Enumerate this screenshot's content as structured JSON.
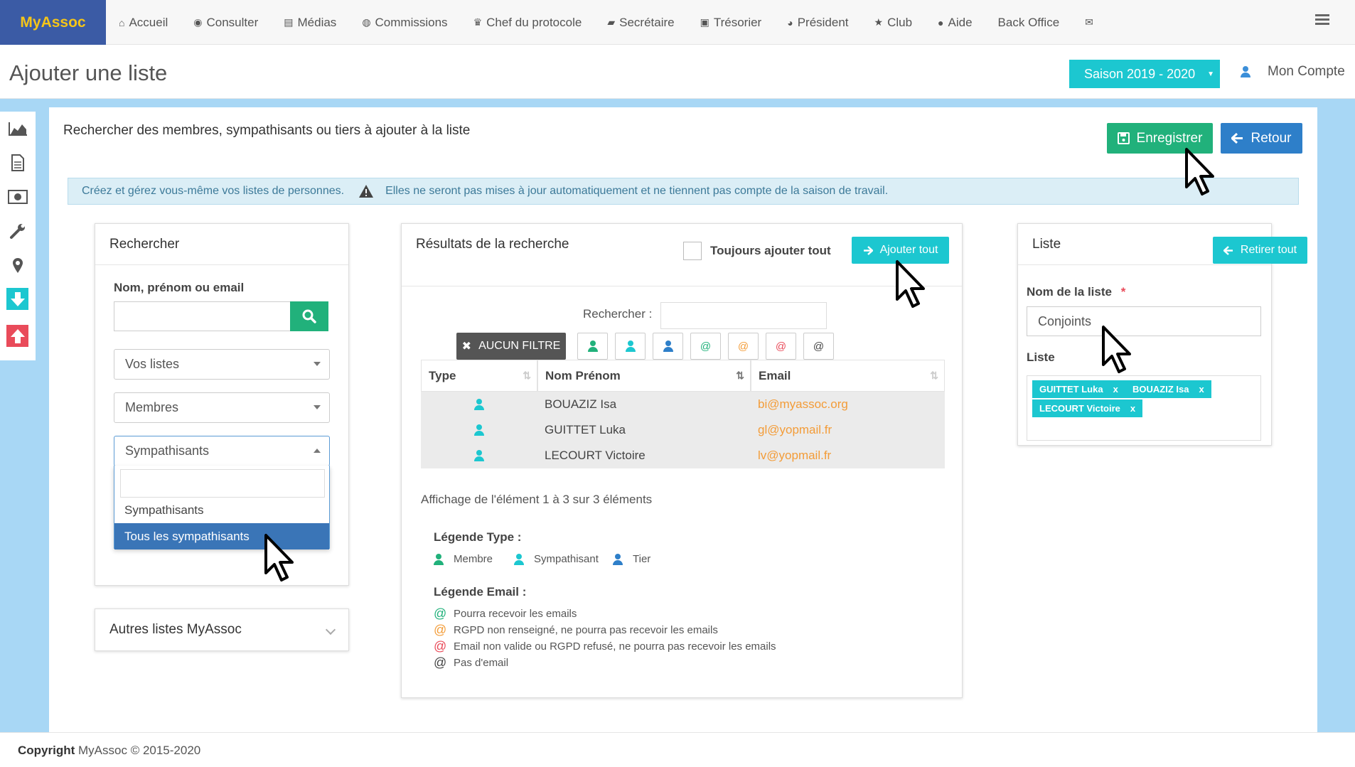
{
  "brand": "MyAssoc",
  "nav": [
    {
      "icon": "home-icon",
      "glyph": "⌂",
      "label": "Accueil"
    },
    {
      "icon": "eye-icon",
      "glyph": "◉",
      "label": "Consulter"
    },
    {
      "icon": "file-icon",
      "glyph": "▤",
      "label": "Médias"
    },
    {
      "icon": "user-circle-icon",
      "glyph": "◍",
      "label": "Commissions"
    },
    {
      "icon": "trophy-icon",
      "glyph": "♛",
      "label": "Chef du protocole"
    },
    {
      "icon": "book-icon",
      "glyph": "▰",
      "label": "Secrétaire"
    },
    {
      "icon": "money-icon",
      "glyph": "▣",
      "label": "Trésorier"
    },
    {
      "icon": "globe-icon",
      "glyph": "◕",
      "label": "Président"
    },
    {
      "icon": "star-icon",
      "glyph": "★",
      "label": "Club"
    },
    {
      "icon": "info-icon",
      "glyph": "●",
      "label": "Aide"
    },
    {
      "icon": "",
      "glyph": "",
      "label": "Back Office"
    },
    {
      "icon": "envelope-icon",
      "glyph": "✉",
      "label": ""
    }
  ],
  "page": {
    "title": "Ajouter une liste",
    "season": "Saison 2019 - 2020",
    "account": "Mon Compte"
  },
  "content": {
    "title": "Rechercher des membres, sympathisants ou tiers à ajouter à la liste",
    "save": "Enregistrer",
    "back": "Retour",
    "info1": "Créez et gérez vous-même vos listes de personnes.",
    "info2": "Elles ne seront pas mises à jour automatiquement et ne tiennent pas compte de la saison de travail."
  },
  "search": {
    "title": "Rechercher",
    "name_label": "Nom, prénom ou email",
    "name_value": "",
    "select1": "Vos listes",
    "select2": "Membres",
    "select3": "Sympathisants",
    "options": [
      "Sympathisants",
      "Tous les sympathisants"
    ],
    "other_lists": "Autres listes MyAssoc"
  },
  "results": {
    "title": "Résultats de la recherche",
    "always_add": "Toujours ajouter tout",
    "add_all": "Ajouter tout",
    "search_label": "Rechercher :",
    "no_filter": "AUCUN FILTRE",
    "columns": [
      "Type",
      "Nom Prénom",
      "Email"
    ],
    "rows": [
      {
        "type": "Sympathisant",
        "name": "BOUAZIZ Isa",
        "email": "bi@myassoc.org"
      },
      {
        "type": "Sympathisant",
        "name": "GUITTET Luka",
        "email": "gl@yopmail.fr"
      },
      {
        "type": "Sympathisant",
        "name": "LECOURT Victoire",
        "email": "lv@yopmail.fr"
      }
    ],
    "showing": "Affichage de l'élément 1 à 3 sur 3 éléments",
    "legend_type_title": "Légende Type :",
    "legend_types": [
      "Membre",
      "Sympathisant",
      "Tier"
    ],
    "legend_email_title": "Légende Email :",
    "legend_emails": [
      {
        "color": "#21b17b",
        "text": "Pourra recevoir les emails"
      },
      {
        "color": "#f39c38",
        "text": "RGPD non renseigné, ne pourra pas recevoir les emails"
      },
      {
        "color": "#e94b5a",
        "text": "Email non valide ou RGPD refusé, ne pourra pas recevoir les emails"
      },
      {
        "color": "#444444",
        "text": "Pas d'email"
      }
    ]
  },
  "list": {
    "title": "Liste",
    "remove_all": "Retirer tout",
    "name_label": "Nom de la liste",
    "required": "*",
    "name_value": "Conjoints",
    "list_label": "Liste",
    "tags": [
      "GUITTET Luka",
      "BOUAZIZ Isa",
      "LECOURT Victoire"
    ]
  },
  "footer": {
    "copyright_label": "Copyright",
    "copyright_text": "MyAssoc © 2015-2020"
  },
  "colors": {
    "brand_bg": "#3b5ba5",
    "brand_text": "#f5c518",
    "accent": "#1cc7d0",
    "success": "#21b17b",
    "primary": "#2e7fc9",
    "danger": "#e94b5a",
    "warning": "#f39c38"
  }
}
